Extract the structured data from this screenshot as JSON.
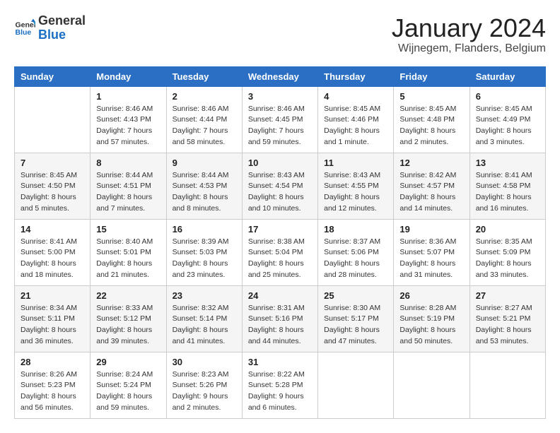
{
  "logo": {
    "general": "General",
    "blue": "Blue"
  },
  "title": "January 2024",
  "subtitle": "Wijnegem, Flanders, Belgium",
  "days_header": [
    "Sunday",
    "Monday",
    "Tuesday",
    "Wednesday",
    "Thursday",
    "Friday",
    "Saturday"
  ],
  "weeks": [
    [
      {
        "day": "",
        "sunrise": "",
        "sunset": "",
        "daylight": ""
      },
      {
        "day": "1",
        "sunrise": "Sunrise: 8:46 AM",
        "sunset": "Sunset: 4:43 PM",
        "daylight": "Daylight: 7 hours and 57 minutes."
      },
      {
        "day": "2",
        "sunrise": "Sunrise: 8:46 AM",
        "sunset": "Sunset: 4:44 PM",
        "daylight": "Daylight: 7 hours and 58 minutes."
      },
      {
        "day": "3",
        "sunrise": "Sunrise: 8:46 AM",
        "sunset": "Sunset: 4:45 PM",
        "daylight": "Daylight: 7 hours and 59 minutes."
      },
      {
        "day": "4",
        "sunrise": "Sunrise: 8:45 AM",
        "sunset": "Sunset: 4:46 PM",
        "daylight": "Daylight: 8 hours and 1 minute."
      },
      {
        "day": "5",
        "sunrise": "Sunrise: 8:45 AM",
        "sunset": "Sunset: 4:48 PM",
        "daylight": "Daylight: 8 hours and 2 minutes."
      },
      {
        "day": "6",
        "sunrise": "Sunrise: 8:45 AM",
        "sunset": "Sunset: 4:49 PM",
        "daylight": "Daylight: 8 hours and 3 minutes."
      }
    ],
    [
      {
        "day": "7",
        "sunrise": "Sunrise: 8:45 AM",
        "sunset": "Sunset: 4:50 PM",
        "daylight": "Daylight: 8 hours and 5 minutes."
      },
      {
        "day": "8",
        "sunrise": "Sunrise: 8:44 AM",
        "sunset": "Sunset: 4:51 PM",
        "daylight": "Daylight: 8 hours and 7 minutes."
      },
      {
        "day": "9",
        "sunrise": "Sunrise: 8:44 AM",
        "sunset": "Sunset: 4:53 PM",
        "daylight": "Daylight: 8 hours and 8 minutes."
      },
      {
        "day": "10",
        "sunrise": "Sunrise: 8:43 AM",
        "sunset": "Sunset: 4:54 PM",
        "daylight": "Daylight: 8 hours and 10 minutes."
      },
      {
        "day": "11",
        "sunrise": "Sunrise: 8:43 AM",
        "sunset": "Sunset: 4:55 PM",
        "daylight": "Daylight: 8 hours and 12 minutes."
      },
      {
        "day": "12",
        "sunrise": "Sunrise: 8:42 AM",
        "sunset": "Sunset: 4:57 PM",
        "daylight": "Daylight: 8 hours and 14 minutes."
      },
      {
        "day": "13",
        "sunrise": "Sunrise: 8:41 AM",
        "sunset": "Sunset: 4:58 PM",
        "daylight": "Daylight: 8 hours and 16 minutes."
      }
    ],
    [
      {
        "day": "14",
        "sunrise": "Sunrise: 8:41 AM",
        "sunset": "Sunset: 5:00 PM",
        "daylight": "Daylight: 8 hours and 18 minutes."
      },
      {
        "day": "15",
        "sunrise": "Sunrise: 8:40 AM",
        "sunset": "Sunset: 5:01 PM",
        "daylight": "Daylight: 8 hours and 21 minutes."
      },
      {
        "day": "16",
        "sunrise": "Sunrise: 8:39 AM",
        "sunset": "Sunset: 5:03 PM",
        "daylight": "Daylight: 8 hours and 23 minutes."
      },
      {
        "day": "17",
        "sunrise": "Sunrise: 8:38 AM",
        "sunset": "Sunset: 5:04 PM",
        "daylight": "Daylight: 8 hours and 25 minutes."
      },
      {
        "day": "18",
        "sunrise": "Sunrise: 8:37 AM",
        "sunset": "Sunset: 5:06 PM",
        "daylight": "Daylight: 8 hours and 28 minutes."
      },
      {
        "day": "19",
        "sunrise": "Sunrise: 8:36 AM",
        "sunset": "Sunset: 5:07 PM",
        "daylight": "Daylight: 8 hours and 31 minutes."
      },
      {
        "day": "20",
        "sunrise": "Sunrise: 8:35 AM",
        "sunset": "Sunset: 5:09 PM",
        "daylight": "Daylight: 8 hours and 33 minutes."
      }
    ],
    [
      {
        "day": "21",
        "sunrise": "Sunrise: 8:34 AM",
        "sunset": "Sunset: 5:11 PM",
        "daylight": "Daylight: 8 hours and 36 minutes."
      },
      {
        "day": "22",
        "sunrise": "Sunrise: 8:33 AM",
        "sunset": "Sunset: 5:12 PM",
        "daylight": "Daylight: 8 hours and 39 minutes."
      },
      {
        "day": "23",
        "sunrise": "Sunrise: 8:32 AM",
        "sunset": "Sunset: 5:14 PM",
        "daylight": "Daylight: 8 hours and 41 minutes."
      },
      {
        "day": "24",
        "sunrise": "Sunrise: 8:31 AM",
        "sunset": "Sunset: 5:16 PM",
        "daylight": "Daylight: 8 hours and 44 minutes."
      },
      {
        "day": "25",
        "sunrise": "Sunrise: 8:30 AM",
        "sunset": "Sunset: 5:17 PM",
        "daylight": "Daylight: 8 hours and 47 minutes."
      },
      {
        "day": "26",
        "sunrise": "Sunrise: 8:28 AM",
        "sunset": "Sunset: 5:19 PM",
        "daylight": "Daylight: 8 hours and 50 minutes."
      },
      {
        "day": "27",
        "sunrise": "Sunrise: 8:27 AM",
        "sunset": "Sunset: 5:21 PM",
        "daylight": "Daylight: 8 hours and 53 minutes."
      }
    ],
    [
      {
        "day": "28",
        "sunrise": "Sunrise: 8:26 AM",
        "sunset": "Sunset: 5:23 PM",
        "daylight": "Daylight: 8 hours and 56 minutes."
      },
      {
        "day": "29",
        "sunrise": "Sunrise: 8:24 AM",
        "sunset": "Sunset: 5:24 PM",
        "daylight": "Daylight: 8 hours and 59 minutes."
      },
      {
        "day": "30",
        "sunrise": "Sunrise: 8:23 AM",
        "sunset": "Sunset: 5:26 PM",
        "daylight": "Daylight: 9 hours and 2 minutes."
      },
      {
        "day": "31",
        "sunrise": "Sunrise: 8:22 AM",
        "sunset": "Sunset: 5:28 PM",
        "daylight": "Daylight: 9 hours and 6 minutes."
      },
      {
        "day": "",
        "sunrise": "",
        "sunset": "",
        "daylight": ""
      },
      {
        "day": "",
        "sunrise": "",
        "sunset": "",
        "daylight": ""
      },
      {
        "day": "",
        "sunrise": "",
        "sunset": "",
        "daylight": ""
      }
    ]
  ]
}
